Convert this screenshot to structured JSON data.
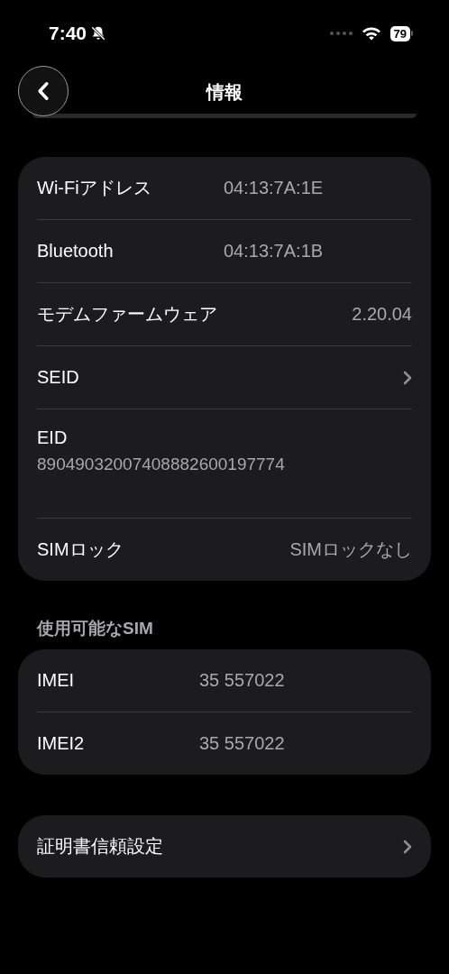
{
  "status_bar": {
    "time": "7:40",
    "battery": "79"
  },
  "nav": {
    "title": "情報"
  },
  "sections": [
    {
      "rows": [
        {
          "kind": "inline",
          "label": "Wi-Fiアドレス",
          "value": "04:13:7A:1E"
        },
        {
          "kind": "inline",
          "label": "Bluetooth",
          "value": "04:13:7A:1B"
        },
        {
          "kind": "right",
          "label": "モデムファームウェア",
          "value": "2.20.04"
        },
        {
          "kind": "link",
          "label": "SEID"
        },
        {
          "kind": "stacked",
          "label": "EID",
          "value": "89049032007408882600197774"
        },
        {
          "kind": "right",
          "label": "SIMロック",
          "value": "SIMロックなし"
        }
      ]
    },
    {
      "header": "使用可能なSIM",
      "rows": [
        {
          "kind": "inline",
          "label": "IMEI",
          "value": "35 557022"
        },
        {
          "kind": "inline",
          "label": "IMEI2",
          "value": "35 557022"
        }
      ]
    },
    {
      "rows": [
        {
          "kind": "link",
          "label": "証明書信頼設定"
        }
      ]
    }
  ]
}
